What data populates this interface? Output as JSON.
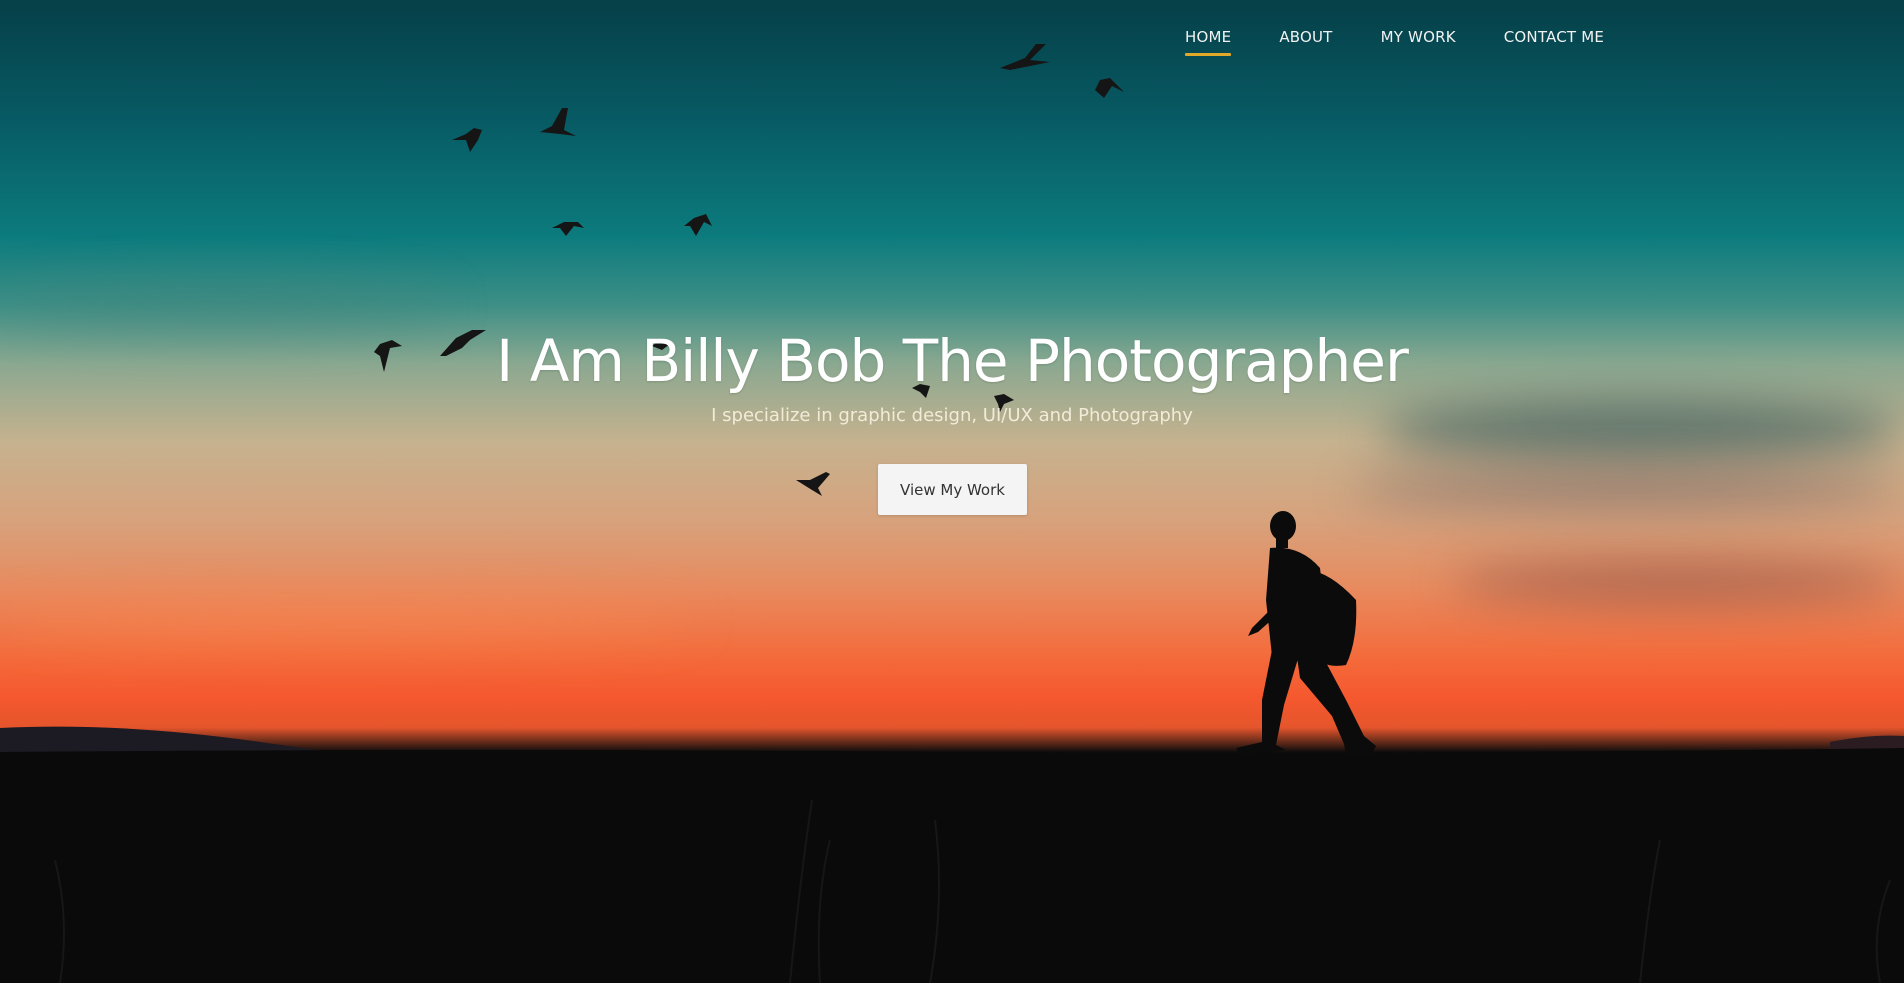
{
  "nav": {
    "items": [
      {
        "label": "HOME",
        "active": true
      },
      {
        "label": "ABOUT",
        "active": false
      },
      {
        "label": "MY WORK",
        "active": false
      },
      {
        "label": "CONTACT ME",
        "active": false
      }
    ],
    "active_indicator_color": "#e0a92a"
  },
  "hero": {
    "title": "I Am Billy Bob The Photographer",
    "subtitle": "I specialize in graphic design, UI/UX and Photography",
    "cta_label": "View My Work",
    "background": {
      "icon": "sunset-silhouette-image",
      "sky_top_color": "#063f48",
      "sky_mid_color": "#0c7b7d",
      "horizon_color": "#f5582e",
      "ground_color": "#070707"
    }
  }
}
